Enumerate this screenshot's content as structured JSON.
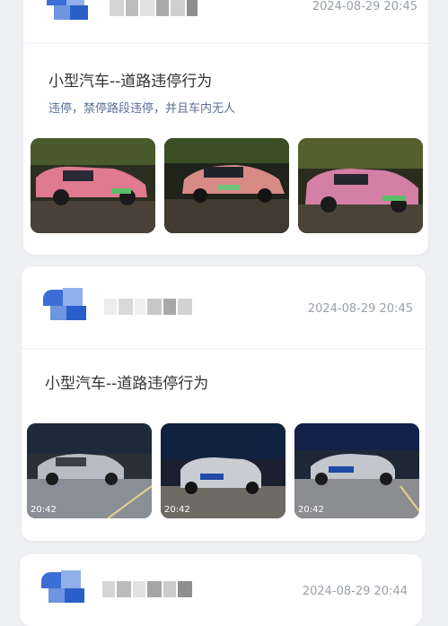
{
  "records": [
    {
      "timestamp": "2024-08-29 20:45",
      "title": "小型汽车--道路违停行为",
      "description": "违停，禁停路段违停，并且车内无人",
      "photos": [
        {
          "subject": "pink-car-night"
        },
        {
          "subject": "pink-car-night-side"
        },
        {
          "subject": "pink-car-night-front"
        }
      ]
    },
    {
      "timestamp": "2024-08-29 20:45",
      "title": "小型汽车--道路违停行为",
      "photos": [
        {
          "subject": "silver-sedan-night",
          "time": "20:42"
        },
        {
          "subject": "silver-sedan-rear-night",
          "time": "20:42"
        },
        {
          "subject": "silver-sedan-front-night",
          "time": "20:42"
        }
      ]
    },
    {
      "timestamp": "2024-08-29 20:44"
    }
  ]
}
